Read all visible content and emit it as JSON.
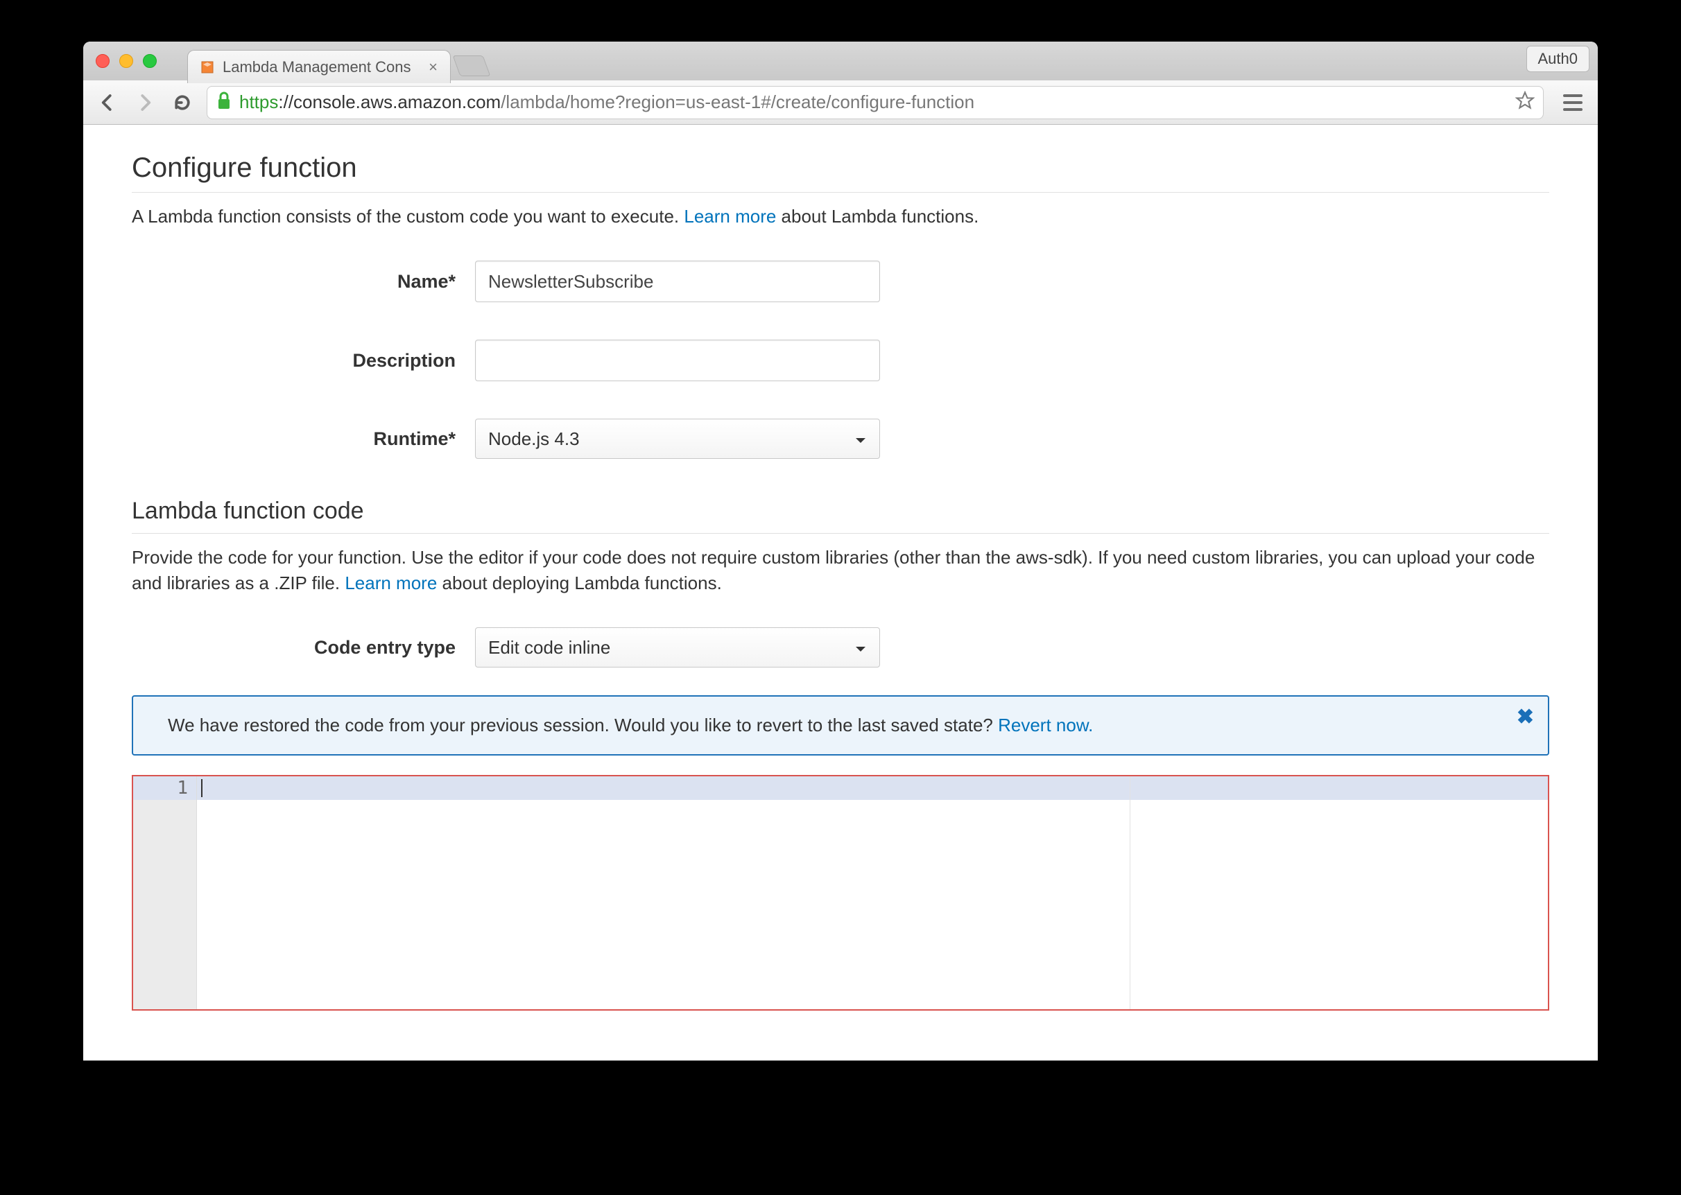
{
  "browser": {
    "tab_title": "Lambda Management Cons",
    "url_https": "https",
    "url_host": "://console.aws.amazon.com",
    "url_path": "/lambda/home?region=us-east-1#/create/configure-function",
    "auth0_label": "Auth0"
  },
  "configure": {
    "heading": "Configure function",
    "desc_before": "A Lambda function consists of the custom code you want to execute. ",
    "learn_more": "Learn more",
    "desc_after": " about Lambda functions.",
    "name_label": "Name*",
    "name_value": "NewsletterSubscribe",
    "description_label": "Description",
    "description_value": "",
    "runtime_label": "Runtime*",
    "runtime_value": "Node.js 4.3"
  },
  "code": {
    "heading": "Lambda function code",
    "desc_before": "Provide the code for your function. Use the editor if your code does not require custom libraries (other than the aws-sdk). If you need custom libraries, you can upload your code and libraries as a .ZIP file. ",
    "learn_more": "Learn more",
    "desc_after": " about deploying Lambda functions.",
    "entry_label": "Code entry type",
    "entry_value": "Edit code inline",
    "alert_text": "We have restored the code from your previous session. Would you like to revert to the last saved state? ",
    "revert_link": "Revert now.",
    "gutter_line": "1"
  }
}
